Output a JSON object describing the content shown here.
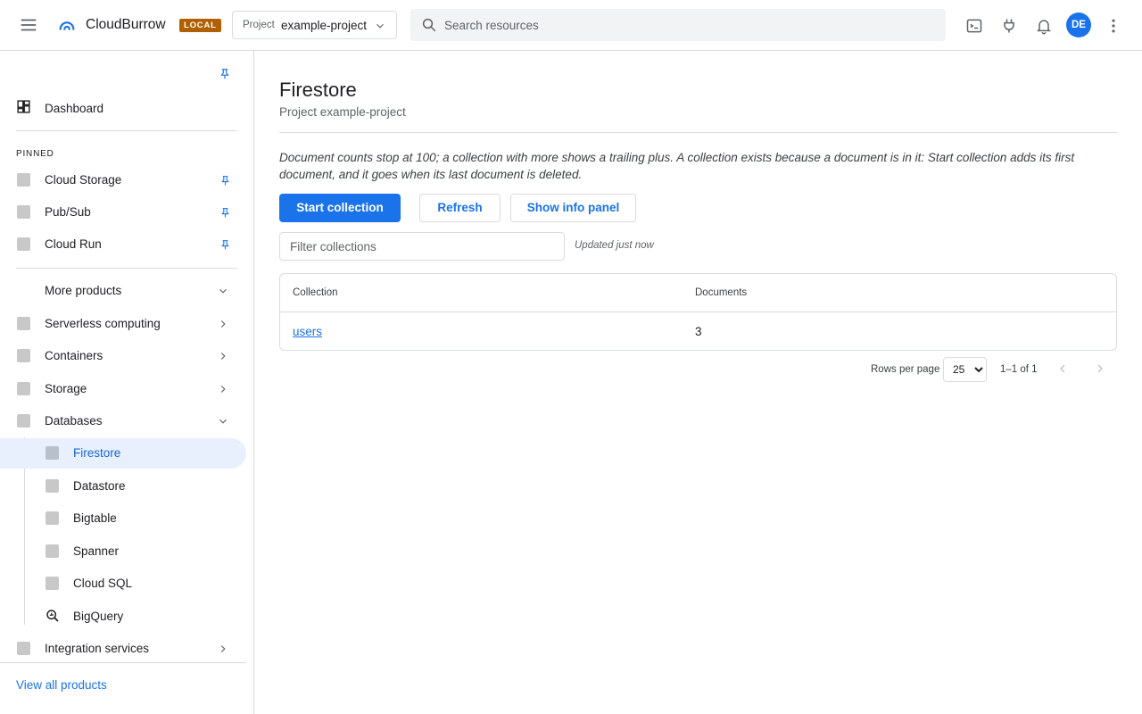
{
  "header": {
    "brand": "CloudBurrow",
    "badge": "LOCAL",
    "project_label": "Project",
    "project_value": "example-project",
    "search_placeholder": "Search resources",
    "avatar_initials": "DE"
  },
  "sidebar": {
    "dashboard_label": "Dashboard",
    "pinned_header": "PINNED",
    "pinned_items": [
      {
        "label": "Cloud Storage"
      },
      {
        "label": "Pub/Sub"
      },
      {
        "label": "Cloud Run"
      }
    ],
    "more_products": "More products",
    "categories": [
      {
        "label": "Serverless computing"
      },
      {
        "label": "Containers"
      },
      {
        "label": "Storage"
      },
      {
        "label": "Databases"
      }
    ],
    "database_items": [
      {
        "label": "Firestore"
      },
      {
        "label": "Datastore"
      },
      {
        "label": "Bigtable"
      },
      {
        "label": "Spanner"
      },
      {
        "label": "Cloud SQL"
      },
      {
        "label": "BigQuery"
      }
    ],
    "integration_services": "Integration services",
    "view_all": "View all products"
  },
  "main": {
    "title": "Firestore",
    "subtitle": "Project example-project",
    "note": "Document counts stop at 100; a collection with more shows a trailing plus. A collection exists because a document is in it: Start collection adds its first document, and it goes when its last document is deleted.",
    "buttons": {
      "start_collection": "Start collection",
      "refresh": "Refresh",
      "show_info": "Show info panel"
    },
    "filter_placeholder": "Filter collections",
    "updated": "Updated just now",
    "table": {
      "columns": [
        "Collection",
        "Documents"
      ],
      "rows": [
        {
          "collection": "users",
          "documents": "3"
        }
      ]
    },
    "pagination": {
      "rows_per_page_label": "Rows per page",
      "rows_per_page_value": "25",
      "range": "1–1 of 1"
    }
  },
  "colors": {
    "accent": "#1a73e8",
    "badge": "#b06000",
    "active_bg": "#e8f0fe"
  }
}
